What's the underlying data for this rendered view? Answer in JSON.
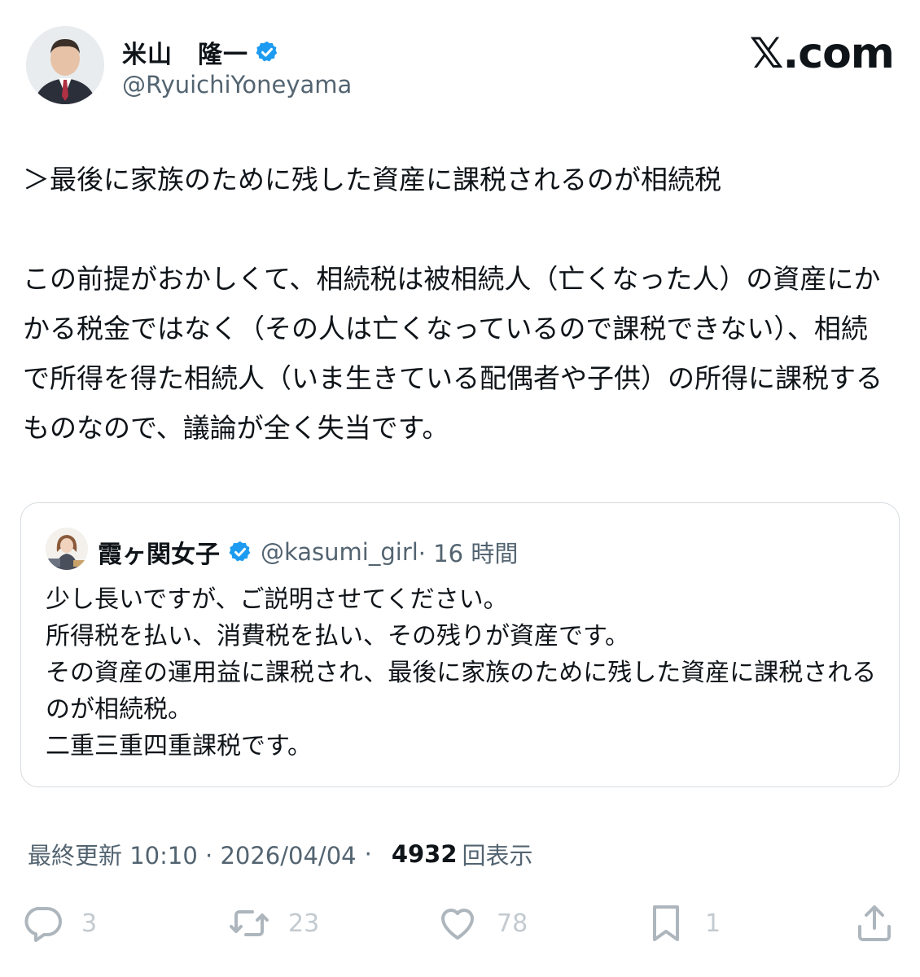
{
  "author": {
    "name": "米山　隆一",
    "handle": "@RyuichiYoneyama",
    "avatar": "man-in-suit-avatar"
  },
  "brand": "𝕏.com",
  "tweet": {
    "text": "＞最後に家族のために残した資産に課税されるのが相続税\n\nこの前提がおかしくて、相続税は被相続人（亡くなった人）の資産にかかる税金ではなく（その人は亡くなっているので課税できない）、相続で所得を得た相続人（いま生きている配偶者や子供）の所得に課税するものなので、議論が全く失当です。"
  },
  "quote": {
    "name": "霞ヶ関女子",
    "handle": "@kasumi_girl",
    "time": "· 16 時間",
    "avatar": "office-woman-avatar",
    "text": "少し長いですが、ご説明させてください。\n所得税を払い、消費税を払い、その残りが資産です。\nその資産の運用益に課税され、最後に家族のために残した資産に課税されるのが相続税。\n二重三重四重課税です。"
  },
  "meta": {
    "updated": "最終更新 10:10 · 2026/04/04",
    "dot": "·",
    "views": "4932",
    "views_label": "回表示"
  },
  "actions": {
    "replies": "3",
    "reposts": "23",
    "likes": "78",
    "bookmarks": "1"
  },
  "colors": {
    "verified": "#1d9bf0",
    "text": "#0f1419",
    "secondary": "#536471"
  }
}
